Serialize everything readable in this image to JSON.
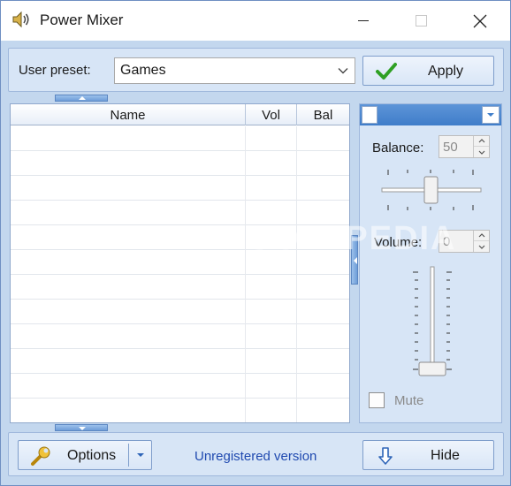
{
  "window": {
    "title": "Power Mixer",
    "icon": "speaker-icon"
  },
  "title_buttons": [
    "minimize-icon",
    "maximize-icon",
    "close-icon"
  ],
  "preset": {
    "label": "User preset:",
    "value": "Games",
    "apply_label": "Apply"
  },
  "list": {
    "columns": [
      "Name",
      "Vol",
      "Bal"
    ],
    "rows": 12
  },
  "controls": {
    "balance_label": "Balance:",
    "balance_value": "50",
    "volume_label": "Volume:",
    "volume_value": "0",
    "mute_label": "Mute",
    "mute_checked": false
  },
  "bottom": {
    "options_label": "Options",
    "status_text": "Unregistered version",
    "hide_label": "Hide"
  },
  "watermark": "SOFTPEDIA",
  "colors": {
    "accent": "#3f7dc9",
    "panel": "#d7e5f6",
    "link": "#1f49b0",
    "apply_check": "#2fa024"
  }
}
